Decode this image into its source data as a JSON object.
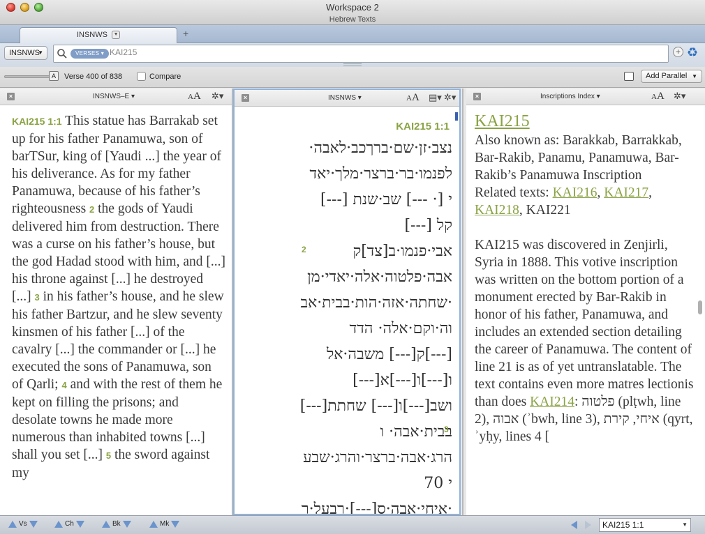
{
  "window": {
    "title": "Workspace 2",
    "subtitle": "Hebrew Texts"
  },
  "tabs": {
    "active_label": "INSNWS",
    "add_label": "+"
  },
  "search": {
    "resource": "INSNWS",
    "type_badge": "VERSES",
    "query": "KAI215"
  },
  "toolbar": {
    "font_btn": "A",
    "verse_count": "Verse 400 of 838",
    "compare_label": "Compare",
    "add_parallel_label": "Add Parallel"
  },
  "panes": {
    "left": {
      "title": "INSNWS–E",
      "font_small": "A",
      "font_big": "A"
    },
    "mid": {
      "title": "INSNWS",
      "font_small": "A",
      "font_big": "A"
    },
    "right": {
      "title": "Inscriptions Index",
      "font_small": "A",
      "font_big": "A"
    }
  },
  "left_text": {
    "ref": "KAI215 1:1",
    "seg1": " This statue has Barrakab set up for his father Panamuwa, son of barTSur, king of [Yaudi ...] the year of his deliverance. As for my father Panamuwa, because of his father’s righteousness ",
    "v2": "2",
    "seg2": " the gods of Yaudi delivered him from destruction. There was a curse on his father’s house, but the god Hadad stood with him, and [...] his throne against [...] he destroyed [...] ",
    "v3": "3",
    "seg3": " in his father’s house, and he slew his father Bartzur, and he slew seventy kinsmen of his father [...] of the cavalry [...] the commander or [...] he executed the sons of Panamuwa, son of Qarli; ",
    "v4": "4",
    "seg4": " and with the rest of them he kept on filling the prisons; and desolate towns he made more numerous than inhabited towns [...] shall you set [...] ",
    "v5": "5",
    "seg5": " the sword against my"
  },
  "mid_text": {
    "ref": "KAI215 1:1",
    "lines": [
      "נצב·זן·שם·ברךכב·לאבה·",
      "לפנמו·בר·ברצר·מלך·יאד",
      "י [·  ---] שב·שנת [---]",
      "קל [---]",
      "אבי·פנמו·ב[צד]ק",
      "אבה·פלטוה·אלה·יאדי·מן",
      "·שחתה·אזה·הות·בבית·אב",
      "וה·וקם·אלה·  הדד",
      "[---]ק[---]  משבה·אל",
      "ו[---]ו[---]א[---]",
      "ושב[---]ו[---]  שחתת[---]",
      "בבית·אבה·  ו",
      "הרג·אבה·ברצר·והרג·שבע",
      "י  70",
      "·איחי·אבה·ס[---]·רבעל·ר"
    ],
    "v2": "2",
    "v3": "3"
  },
  "right_text": {
    "heading": "KAI215",
    "aka": "Also known as: Barakkab, Barrakkab, Bar-Rakib, Panamu, Panamuwa, Bar-Rakib’s Panamuwa Inscription",
    "related_label": "Related texts: ",
    "rel1": "KAI216",
    "sep1": ", ",
    "rel2": "KAI217",
    "sep2": ", ",
    "rel3": "KAI218",
    "rel_tail": ", KAI221",
    "para1": "KAI215 was discovered in Zenjirli, Syria in 1888. This votive inscription was written on the bottom portion of a monument erected by Bar-Rakib in honor of his father, Panamuwa, and includes an extended section detailing the career of Panamuwa. The content of line 21 is as of yet untranslatable. The text contains even more matres lectionis than does ",
    "link_kai214": "KAI214",
    "para2": ": פלטוה (plṭwh, line 2), אבוה (ʾbwh, line 3), איחי, קירת (qyrt, ʾyḥy, lines 4 ["
  },
  "statusbar": {
    "nav": [
      {
        "label": "Vs"
      },
      {
        "label": "Ch"
      },
      {
        "label": "Bk"
      },
      {
        "label": "Mk"
      }
    ],
    "goto": "KAI215 1:1"
  },
  "colors": {
    "accent_green": "#8aa344",
    "selection_blue": "#8fb3dc",
    "nav_blue": "#6b93cc"
  }
}
